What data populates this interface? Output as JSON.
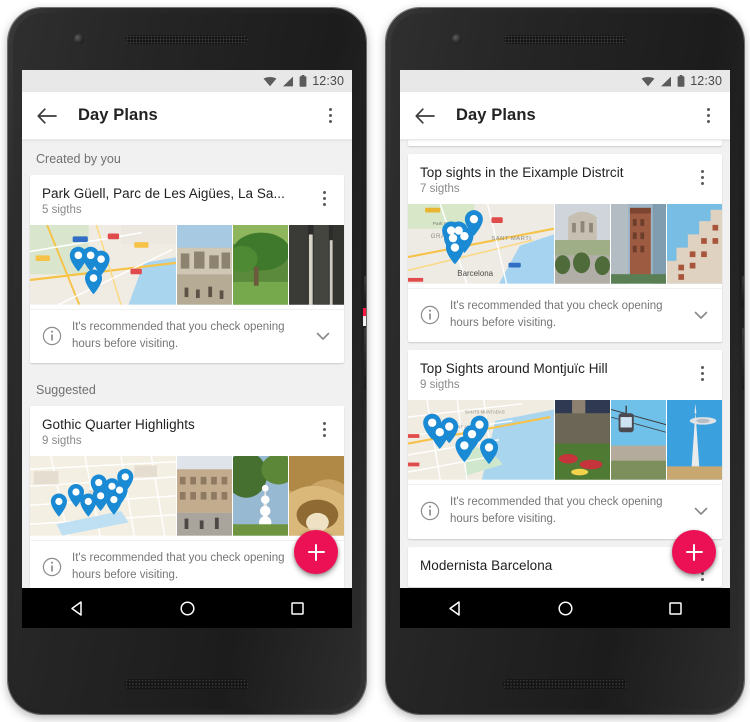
{
  "meta": {
    "app_title": "Day Plans",
    "screens": 2
  },
  "status_bar": {
    "clock": "12:30",
    "icons": [
      "wifi-icon",
      "signal-icon",
      "battery-icon"
    ]
  },
  "app_bar": {
    "back_icon": "back-arrow-icon",
    "title": "Day Plans",
    "overflow_icon": "overflow-menu-icon"
  },
  "info_notice": {
    "icon": "info-circle-icon",
    "text": "It's recommended that you check opening hours before visiting.",
    "expand_icon": "chevron-down-icon"
  },
  "fab": {
    "icon": "plus-icon",
    "color": "#ec1055",
    "label": "Add"
  },
  "nav_bar": {
    "back": "nav-back-triangle-icon",
    "home": "nav-home-circle-icon",
    "recents": "nav-recents-square-icon"
  },
  "left_phone": {
    "sections": [
      {
        "label": "Created by you",
        "cards": [
          {
            "title": "Park Güell, Parc de Les Aigües, La Sa...",
            "subtitle": "5 sigths",
            "menu_icon": "overflow-menu-icon",
            "map_pins": 4,
            "thumbs": [
              "map-thumbnail",
              "photo-park-guell-terrace",
              "photo-green-garden",
              "photo-stone-arches"
            ]
          }
        ]
      },
      {
        "label": "Suggested",
        "cards": [
          {
            "title": "Gothic Quarter Highlights",
            "subtitle": "9 sigths",
            "menu_icon": "overflow-menu-icon",
            "map_pins": 9,
            "thumbs": [
              "map-thumbnail",
              "photo-gothic-street",
              "photo-sagrada-spire",
              "photo-stone-vault"
            ]
          }
        ]
      }
    ]
  },
  "right_phone": {
    "cards": [
      {
        "title": "Top sights in the Eixample Distrcit",
        "subtitle": "7 sigths",
        "menu_icon": "overflow-menu-icon",
        "map_pins": 6,
        "map_labels": [
          "GRACIA",
          "SANT MARTI",
          "Barcelona",
          "Park Güell"
        ],
        "thumbs": [
          "map-thumbnail",
          "photo-placa-catalunya",
          "photo-torre-aigues",
          "photo-casa-mila"
        ]
      },
      {
        "title": "Top Sights around Montjuïc Hill",
        "subtitle": "9 sigths",
        "menu_icon": "overflow-menu-icon",
        "map_pins": 7,
        "thumbs": [
          "map-thumbnail",
          "photo-montjuic-castle-gardens",
          "photo-cable-car",
          "photo-torre-calatrava"
        ]
      },
      {
        "title": "Modernista Barcelona",
        "subtitle": "",
        "menu_icon": "overflow-menu-icon"
      }
    ]
  }
}
